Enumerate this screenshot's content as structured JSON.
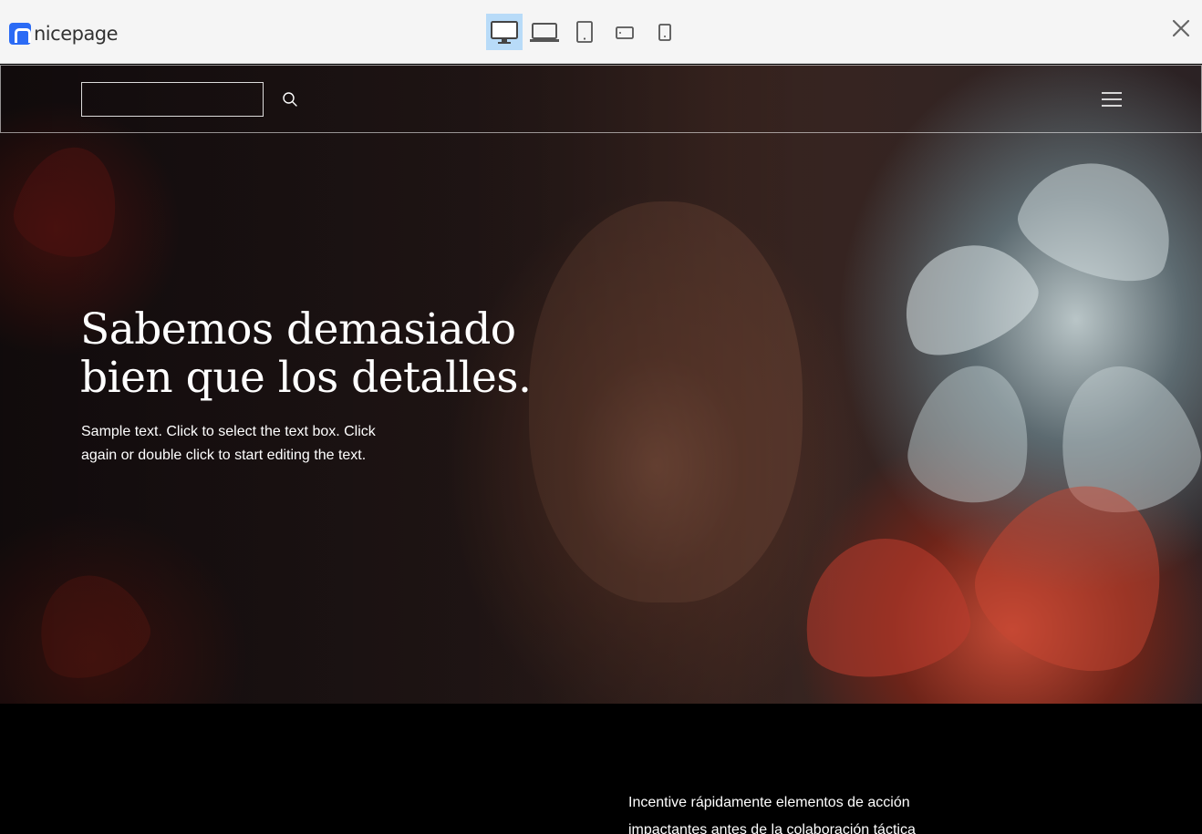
{
  "app": {
    "brand": "nicepage",
    "brand_color": "#2b6bf5"
  },
  "toolbar": {
    "devices": [
      {
        "name": "desktop",
        "icon": "desktop-icon",
        "active": true
      },
      {
        "name": "laptop",
        "icon": "laptop-icon",
        "active": false
      },
      {
        "name": "tablet",
        "icon": "tablet-icon",
        "active": false
      },
      {
        "name": "phone-landscape",
        "icon": "phone-landscape-icon",
        "active": false
      },
      {
        "name": "phone-portrait",
        "icon": "phone-portrait-icon",
        "active": false
      }
    ],
    "active_color": "#b8dbf8",
    "close_icon": "close-icon"
  },
  "page": {
    "header": {
      "search": {
        "placeholder": "",
        "value": "",
        "icon": "search-icon"
      },
      "menu_icon": "hamburger-menu-icon"
    },
    "hero": {
      "headline": "Sabemos demasiado bien que los detalles.",
      "body": "Sample text. Click to select the text box. Click again or double click to start editing the text."
    },
    "section2": {
      "body": "Incentive rápidamente elementos de acción impactantes antes de la colaboración táctica"
    }
  }
}
